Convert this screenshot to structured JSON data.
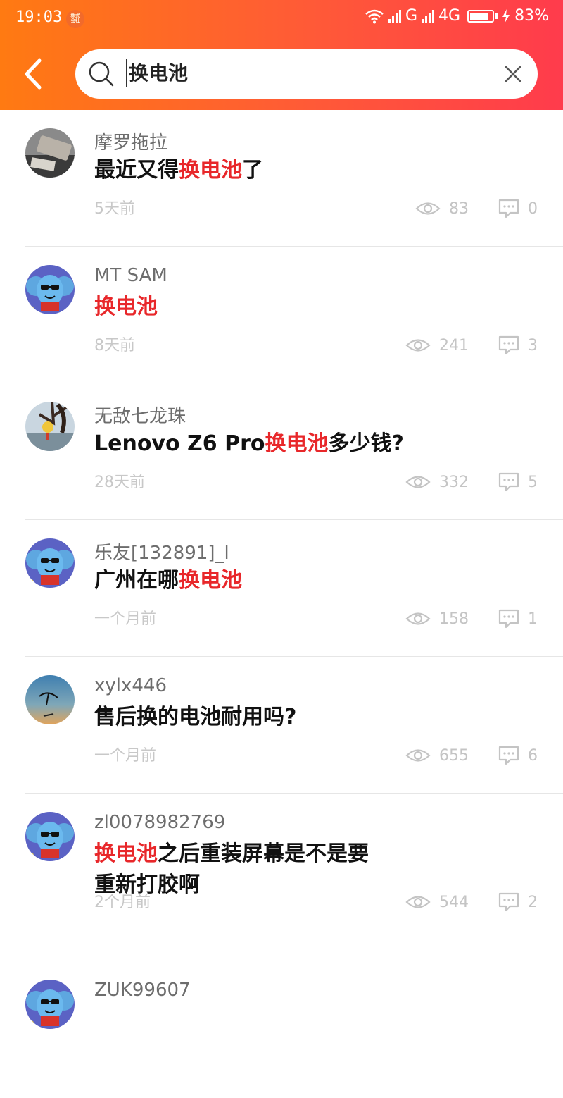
{
  "status": {
    "time": "19:03",
    "net1": "G",
    "net2": "4G",
    "battery": "83%",
    "battery_level": 0.83,
    "notif_glyph": "㍿"
  },
  "search": {
    "query": "换电池"
  },
  "posts": [
    {
      "author": "摩罗拖拉",
      "pre": "最近又得",
      "hl": "换电池",
      "post": "了",
      "post2": "",
      "time": "5天前",
      "views": "83",
      "comments": "0",
      "avatar": "photo-gray"
    },
    {
      "author": "MT SAM",
      "pre": "",
      "hl": "换电池",
      "post": "",
      "post2": "",
      "time": "8天前",
      "views": "241",
      "comments": "3",
      "avatar": "elephant"
    },
    {
      "author": "无敌七龙珠",
      "pre": "Lenovo Z6 Pro",
      "hl": "换电池",
      "post": "多少钱?",
      "post2": "",
      "time": "28天前",
      "views": "332",
      "comments": "5",
      "avatar": "photo-tree"
    },
    {
      "author": "乐友[132891]_l",
      "pre": "广州在哪",
      "hl": "换电池",
      "post": "",
      "post2": "",
      "time": "一个月前",
      "views": "158",
      "comments": "1",
      "avatar": "elephant"
    },
    {
      "author": "xylx446",
      "pre": "售后换的电池耐用吗?",
      "hl": "",
      "post": "",
      "post2": "",
      "time": "一个月前",
      "views": "655",
      "comments": "6",
      "avatar": "photo-bird"
    },
    {
      "author": "zl0078982769",
      "pre": "",
      "hl": "换电池",
      "post": "之后重装屏幕是不是要",
      "post2": "重新打胶啊",
      "time": "2个月前",
      "views": "544",
      "comments": "2",
      "avatar": "elephant"
    },
    {
      "author": "ZUK99607",
      "pre": "",
      "hl": "",
      "post": "",
      "post2": "",
      "time": "",
      "views": "",
      "comments": "",
      "avatar": "elephant"
    }
  ]
}
